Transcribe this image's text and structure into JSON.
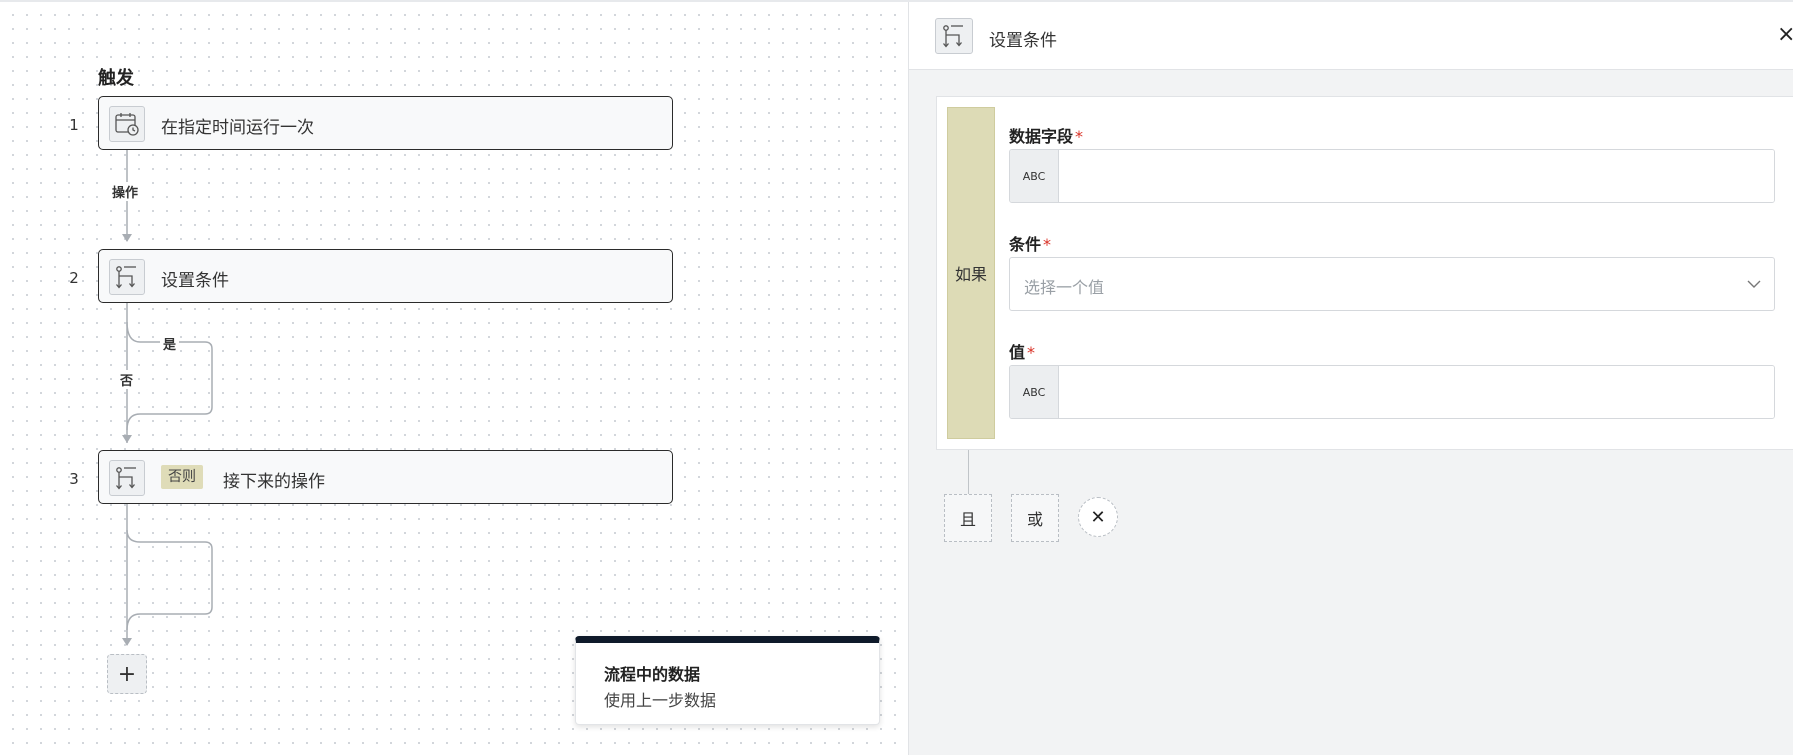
{
  "canvas": {
    "trigger_heading": "触发",
    "steps": [
      {
        "number": "1",
        "label": "在指定时间运行一次",
        "icon": "calendar-clock-icon"
      },
      {
        "number": "2",
        "label": "设置条件",
        "icon": "branch-icon"
      },
      {
        "number": "3",
        "badge": "否则",
        "label": "接下来的操作",
        "icon": "branch-icon"
      }
    ],
    "wire_labels": {
      "action": "操作",
      "yes": "是",
      "no": "否"
    },
    "add_step_symbol": "+",
    "flow_data": {
      "title": "流程中的数据",
      "subtitle": "使用上一步数据"
    }
  },
  "panel": {
    "title": "设置条件",
    "close_symbol": "×",
    "if_label": "如果",
    "fields": {
      "data_field": {
        "label": "数据字段",
        "required_mark": "*",
        "prefix": "ABC",
        "value": ""
      },
      "condition": {
        "label": "条件",
        "required_mark": "*",
        "placeholder": "选择一个值"
      },
      "value": {
        "label": "值",
        "required_mark": "*",
        "prefix": "ABC",
        "value": ""
      }
    },
    "logic": {
      "and": "且",
      "or": "或",
      "remove_symbol": "✕"
    }
  },
  "colors": {
    "accent_dark": "#0f1a2a",
    "if_bar": "#dddbb6",
    "required": "#d93025"
  }
}
